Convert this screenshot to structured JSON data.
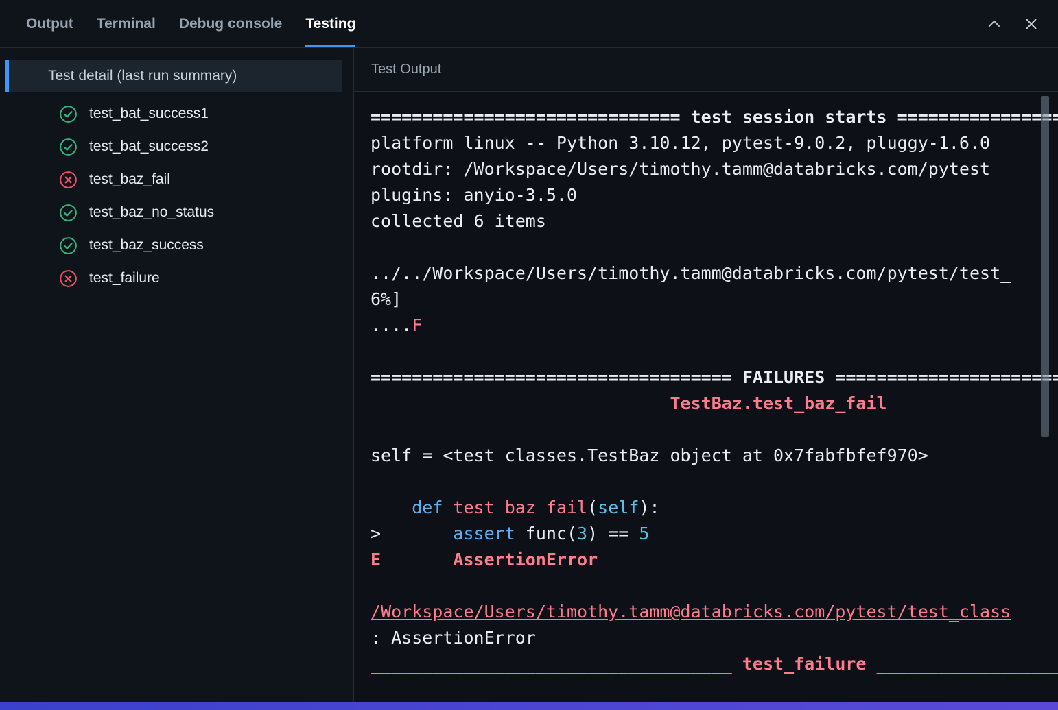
{
  "colors": {
    "accent_blue": "#3f96f5",
    "tab_underline": "#3f96f5",
    "green": "#35b477",
    "red": "#ef4f62",
    "terminal_red": "#ff7b8e",
    "terminal_blue": "#61aeee",
    "terminal_cyan": "#58c1e8",
    "terminal_fg": "#e8edf3",
    "bottom_bar": "#4443cf"
  },
  "tabs": {
    "items": [
      {
        "label": "Output",
        "active": false
      },
      {
        "label": "Terminal",
        "active": false
      },
      {
        "label": "Debug console",
        "active": false
      },
      {
        "label": "Testing",
        "active": true
      }
    ]
  },
  "window_controls": {
    "collapse_icon": "chevron-up",
    "close_icon": "x"
  },
  "sidebar": {
    "header": "Test detail (last run summary)",
    "tests": [
      {
        "name": "test_bat_success1",
        "status": "pass"
      },
      {
        "name": "test_bat_success2",
        "status": "pass"
      },
      {
        "name": "test_baz_fail",
        "status": "fail"
      },
      {
        "name": "test_baz_no_status",
        "status": "pass"
      },
      {
        "name": "test_baz_success",
        "status": "pass"
      },
      {
        "name": "test_failure",
        "status": "fail"
      }
    ]
  },
  "output": {
    "header": "Test Output",
    "lines": [
      {
        "segments": [
          {
            "t": "============================== test session starts ==================================",
            "c": "b"
          }
        ]
      },
      {
        "segments": [
          {
            "t": "platform linux -- Python 3.10.12, pytest-9.0.2, pluggy-1.6.0",
            "c": "p"
          }
        ]
      },
      {
        "segments": [
          {
            "t": "rootdir: /Workspace/Users/timothy.tamm@databricks.com/pytest",
            "c": "p"
          }
        ]
      },
      {
        "segments": [
          {
            "t": "plugins: anyio-3.5.0",
            "c": "p"
          }
        ]
      },
      {
        "segments": [
          {
            "t": "collected 6 items",
            "c": "p"
          }
        ]
      },
      {
        "segments": []
      },
      {
        "segments": [
          {
            "t": "../../Workspace/Users/timothy.tamm@databricks.com/pytest/test_",
            "c": "p"
          }
        ]
      },
      {
        "segments": [
          {
            "t": "6%]",
            "c": "p"
          }
        ]
      },
      {
        "segments": [
          {
            "t": "....",
            "c": "p"
          },
          {
            "t": "F",
            "c": "r"
          }
        ]
      },
      {
        "segments": []
      },
      {
        "segments": [
          {
            "t": "=================================== FAILURES ========================================",
            "c": "b"
          }
        ]
      },
      {
        "segments": [
          {
            "t": "____________________________ ",
            "c": "r"
          },
          {
            "t": "TestBaz.test_baz_fail",
            "c": "rb"
          },
          {
            "t": " __________________________________",
            "c": "r"
          }
        ]
      },
      {
        "segments": []
      },
      {
        "segments": [
          {
            "t": "self = <test_classes.TestBaz object at 0x7fabfbfef970>",
            "c": "p"
          }
        ]
      },
      {
        "segments": []
      },
      {
        "segments": [
          {
            "t": "    ",
            "c": "p"
          },
          {
            "t": "def",
            "c": "kw"
          },
          {
            "t": " ",
            "c": "p"
          },
          {
            "t": "test_baz_fail",
            "c": "r"
          },
          {
            "t": "(",
            "c": "p"
          },
          {
            "t": "self",
            "c": "cy"
          },
          {
            "t": "):",
            "c": "p"
          }
        ]
      },
      {
        "segments": [
          {
            "t": ">       ",
            "c": "p"
          },
          {
            "t": "assert",
            "c": "kw"
          },
          {
            "t": " func(",
            "c": "p"
          },
          {
            "t": "3",
            "c": "cy"
          },
          {
            "t": ") == ",
            "c": "p"
          },
          {
            "t": "5",
            "c": "cy"
          }
        ]
      },
      {
        "segments": [
          {
            "t": "E       AssertionError",
            "c": "rb"
          }
        ]
      },
      {
        "segments": []
      },
      {
        "segments": [
          {
            "t": "/Workspace/Users/timothy.tamm@databricks.com/pytest/test_class",
            "c": "link"
          }
        ]
      },
      {
        "segments": [
          {
            "t": ": AssertionError",
            "c": "p"
          }
        ]
      },
      {
        "segments": [
          {
            "t": "___________________________________ ",
            "c": "r"
          },
          {
            "t": "test_failure",
            "c": "rb"
          },
          {
            "t": " ____________________________________",
            "c": "r"
          }
        ]
      }
    ]
  }
}
